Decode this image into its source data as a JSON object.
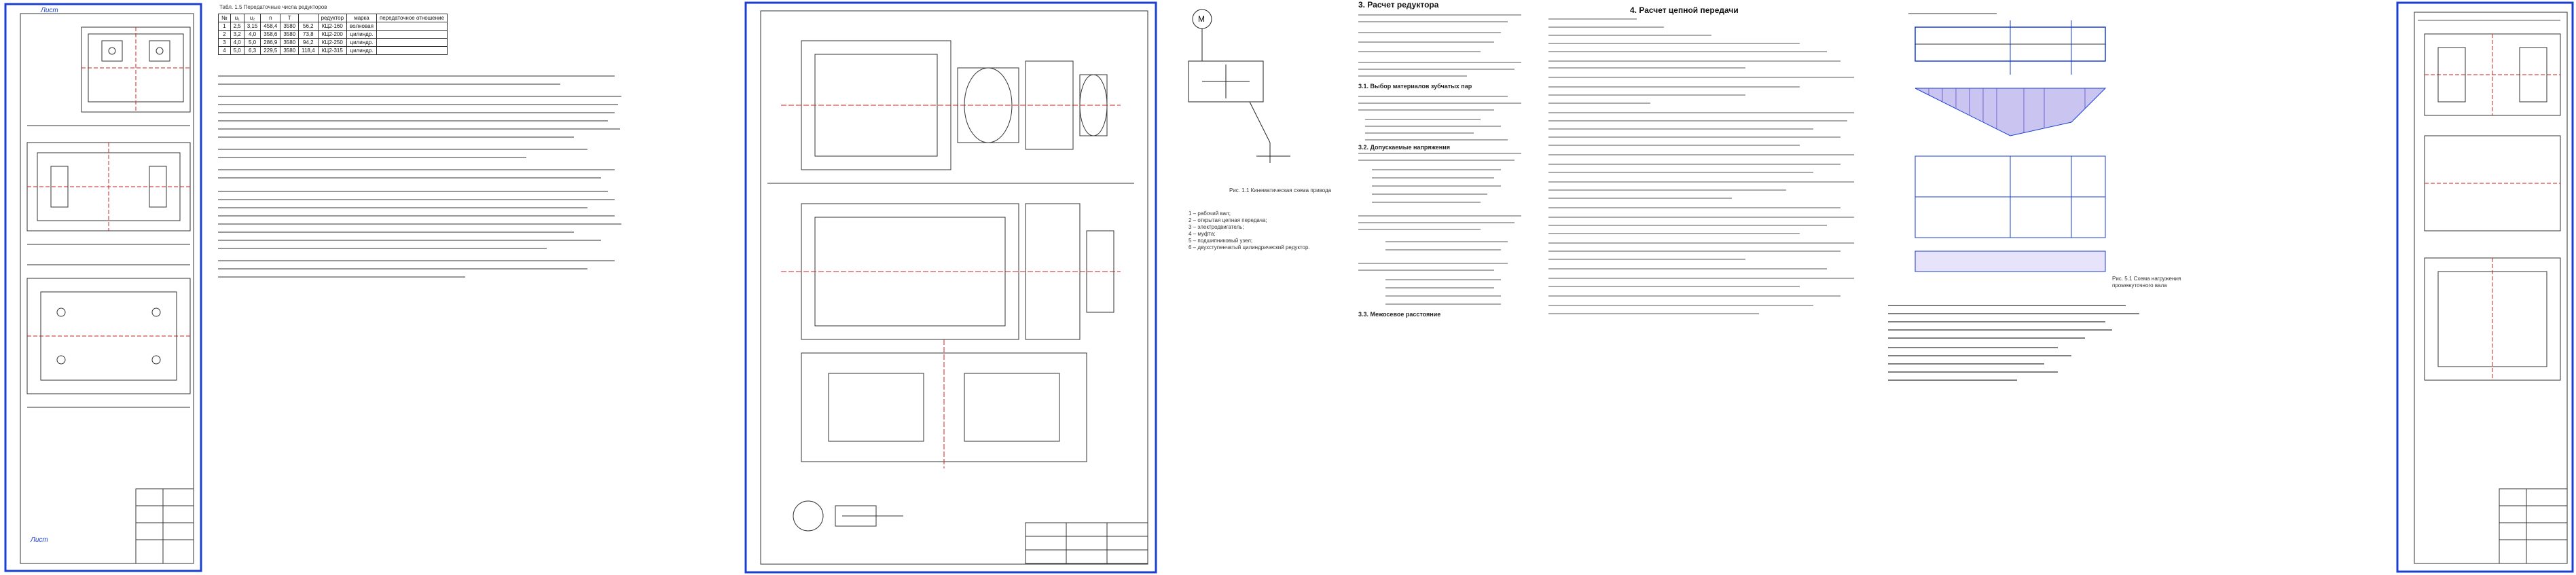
{
  "table_caption": "Табл. 1.5 Передаточные числа редукторов",
  "table_headers": [
    "№",
    "u₁",
    "u₂",
    "n",
    "T",
    "",
    "редуктор",
    "марка",
    "передаточное отношение"
  ],
  "table_rows": [
    [
      "1",
      "2,5",
      "3,15",
      "458,4",
      "3580",
      "56,2",
      "КЦ2-160",
      "волновая"
    ],
    [
      "2",
      "3,2",
      "4,0",
      "358,6",
      "3580",
      "73,8",
      "КЦ2-200",
      "цилиндр."
    ],
    [
      "3",
      "4,0",
      "5,0",
      "286,9",
      "3580",
      "94,2",
      "КЦ2-250",
      "цилиндр."
    ],
    [
      "4",
      "5,0",
      "6,3",
      "229,5",
      "3580",
      "118,4",
      "КЦ2-315",
      "цилиндр."
    ]
  ],
  "section3_title": "3. Расчет редуктора",
  "section4_title": "4. Расчет цепной передачи",
  "section33_title": "3.3.  Межосевое расстояние",
  "sub31": "3.1.   Выбор материалов зубчатых пар",
  "sub32": "3.2.   Допускаемые напряжения",
  "fig_caption_left": "Рис. 1.1 Кинематическая схема привода",
  "fig_caption_right": "Рис. 5.1 Схема нагружения промежуточного вала",
  "legend": [
    "1 – рабочий вал;",
    "2 – открытая цепная передача;",
    "3 – электродвигатель;",
    "4 – муфта;",
    "5 – подшипниковый узел;",
    "6 – двухступенчатый цилиндрический редуктор."
  ],
  "stamp_top": "Лист",
  "stamp_bottom": "Лист"
}
